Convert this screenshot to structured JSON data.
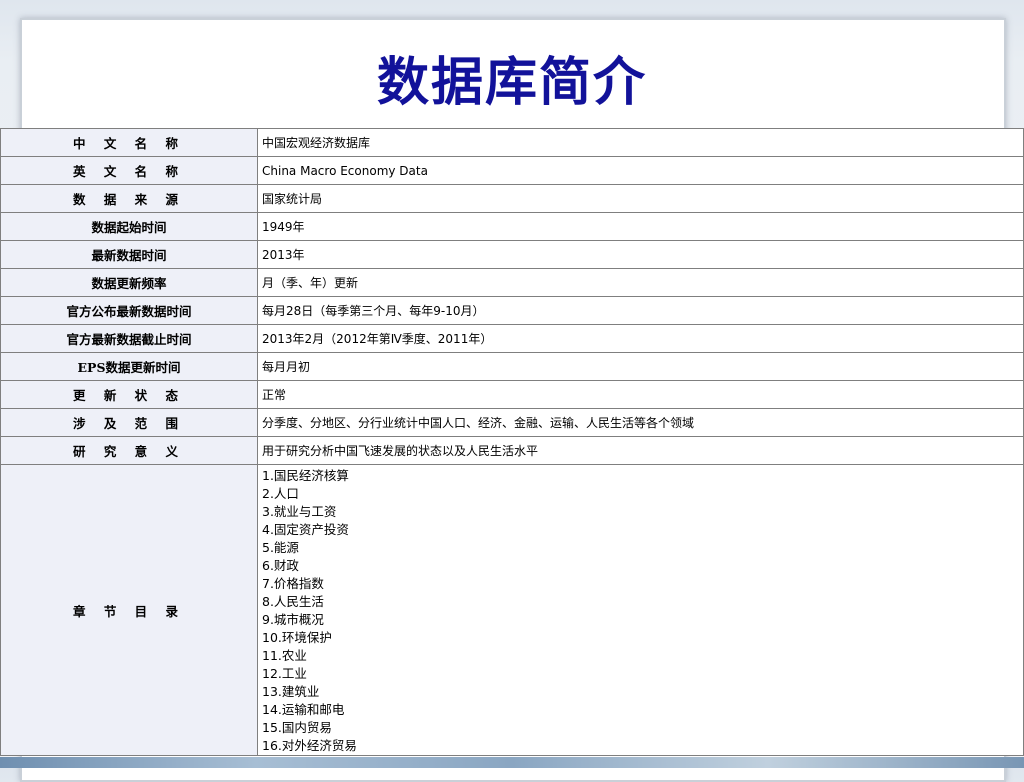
{
  "slide": {
    "title": "数据库简介"
  },
  "table": {
    "rows": [
      {
        "label": "中 文 名 称",
        "value": "中国宏观经济数据库"
      },
      {
        "label": "英 文 名 称",
        "value": "China Macro Economy Data"
      },
      {
        "label": "数 据 来 源",
        "value": "国家统计局"
      },
      {
        "label": "数据起始时间",
        "value": "1949年"
      },
      {
        "label": "最新数据时间",
        "value": "2013年"
      },
      {
        "label": "数据更新频率",
        "value": "月（季、年）更新"
      },
      {
        "label": "官方公布最新数据时间",
        "value": "每月28日（每季第三个月、每年9-10月）"
      },
      {
        "label": "官方最新数据截止时间",
        "value": "2013年2月（2012年第Ⅳ季度、2011年）"
      },
      {
        "label": "EPS数据更新时间",
        "value": "每月月初"
      },
      {
        "label": "更 新 状 态",
        "value": "正常"
      },
      {
        "label": "涉 及 范 围",
        "value": "分季度、分地区、分行业统计中国人口、经济、金融、运输、人民生活等各个领域"
      },
      {
        "label": "研 究 意 义",
        "value": "用于研究分析中国飞速发展的状态以及人民生活水平"
      }
    ],
    "chapters": {
      "label": "章 节 目 录",
      "items": [
        "1.国民经济核算",
        "2.人口",
        "3.就业与工资",
        "4.固定资产投资",
        "5.能源",
        "6.财政",
        "7.价格指数",
        "8.人民生活",
        "9.城市概况",
        "10.环境保护",
        "11.农业",
        "12.工业",
        "13.建筑业",
        "14.运输和邮电",
        "15.国内贸易",
        "16.对外经济贸易"
      ]
    }
  }
}
